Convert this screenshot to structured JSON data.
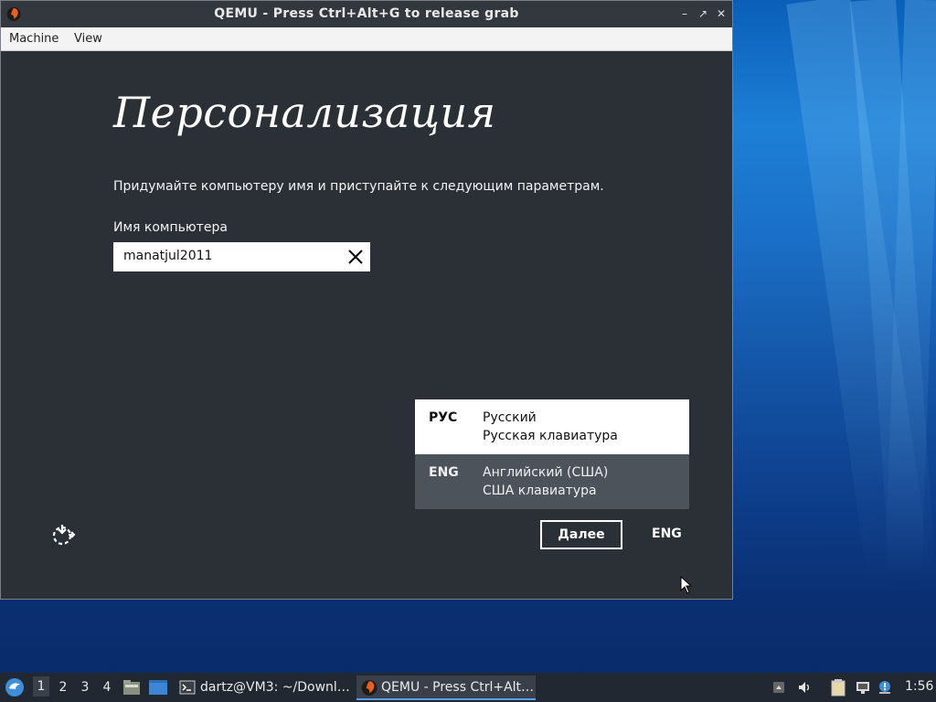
{
  "window": {
    "title": "QEMU - Press Ctrl+Alt+G to release grab",
    "controls": {
      "minimize": "–",
      "maximize": "↗",
      "close": "✕"
    }
  },
  "menubar": {
    "items": [
      "Machine",
      "View"
    ]
  },
  "guest": {
    "heading": "Персонализация",
    "subtitle": "Придумайте компьютеру имя и приступайте к следующим параметрам.",
    "computer_name_label": "Имя компьютера",
    "computer_name_value": "manatjul2011",
    "language_options": [
      {
        "code": "РУС",
        "language": "Русский",
        "keyboard": "Русская клавиатура",
        "highlighted": false
      },
      {
        "code": "ENG",
        "language": "Английский (США)",
        "keyboard": "США клавиатура",
        "highlighted": true
      }
    ],
    "next_label": "Далее",
    "current_language": "ENG"
  },
  "taskbar": {
    "workspaces": [
      "1",
      "2",
      "3",
      "4"
    ],
    "active_workspace": "1",
    "tasks": [
      {
        "label": "dartz@VM3: ~/Downl…",
        "icon": "terminal-icon"
      },
      {
        "label": "QEMU - Press Ctrl+Alt…",
        "icon": "qemu-icon",
        "active": true
      }
    ],
    "clock": "1:56"
  },
  "colors": {
    "guest_bg": "#2b3037",
    "eng_row_bg": "#4c535b",
    "taskbar_bg": "#222831",
    "desktop_blue": "#1a6fc6"
  }
}
